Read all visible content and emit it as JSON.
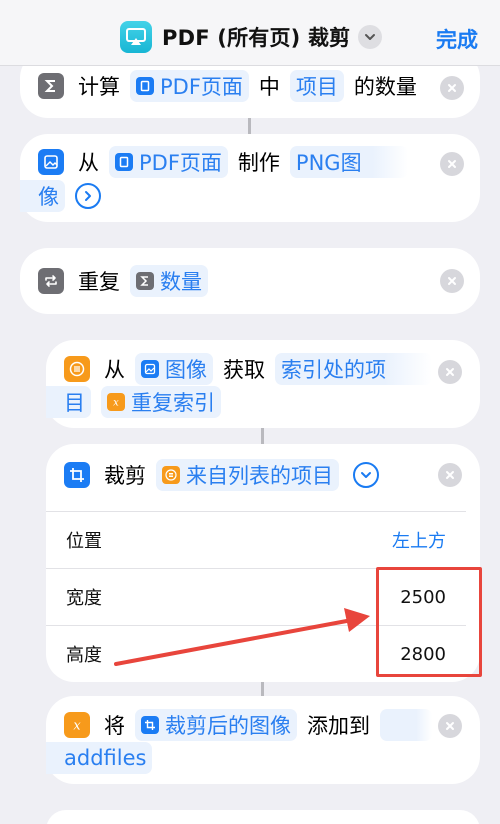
{
  "navbar": {
    "title": "PDF (所有页) 裁剪",
    "done_label": "完成",
    "app_icon": "airplay-icon",
    "title_menu_icon": "chevron-down-icon"
  },
  "actions": {
    "count": {
      "icon": "sigma-icon",
      "verb": "计算",
      "input": "PDF页面",
      "mid": "中",
      "item_type": "项目",
      "tail": "的数量"
    },
    "make_image": {
      "icon": "image-icon",
      "verb": "从",
      "input": "PDF页面",
      "mid": "制作",
      "format_line1": "PNG图",
      "format_line2": "像"
    },
    "repeat": {
      "icon": "repeat-icon",
      "verb": "重复",
      "count_var": "数量"
    },
    "get_item": {
      "icon": "list-icon",
      "verb": "从",
      "source": "图像",
      "mid": "获取",
      "mode_line1": "索引处的项",
      "mode_line2": "目",
      "index_var": "重复索引"
    },
    "crop": {
      "icon": "crop-icon",
      "verb": "裁剪",
      "input": "来自列表的项目",
      "params": [
        {
          "label": "位置",
          "value": "左上方"
        },
        {
          "label": "宽度",
          "value": "2500"
        },
        {
          "label": "高度",
          "value": "2800"
        }
      ]
    },
    "add_to_var": {
      "icon": "variable-icon",
      "verb": "将",
      "input": "裁剪后的图像",
      "mid": "添加到",
      "variable": "addfiles"
    }
  },
  "colors": {
    "accent": "#1a7bf2",
    "annotation": "#e8453c",
    "background": "#efeff4"
  }
}
